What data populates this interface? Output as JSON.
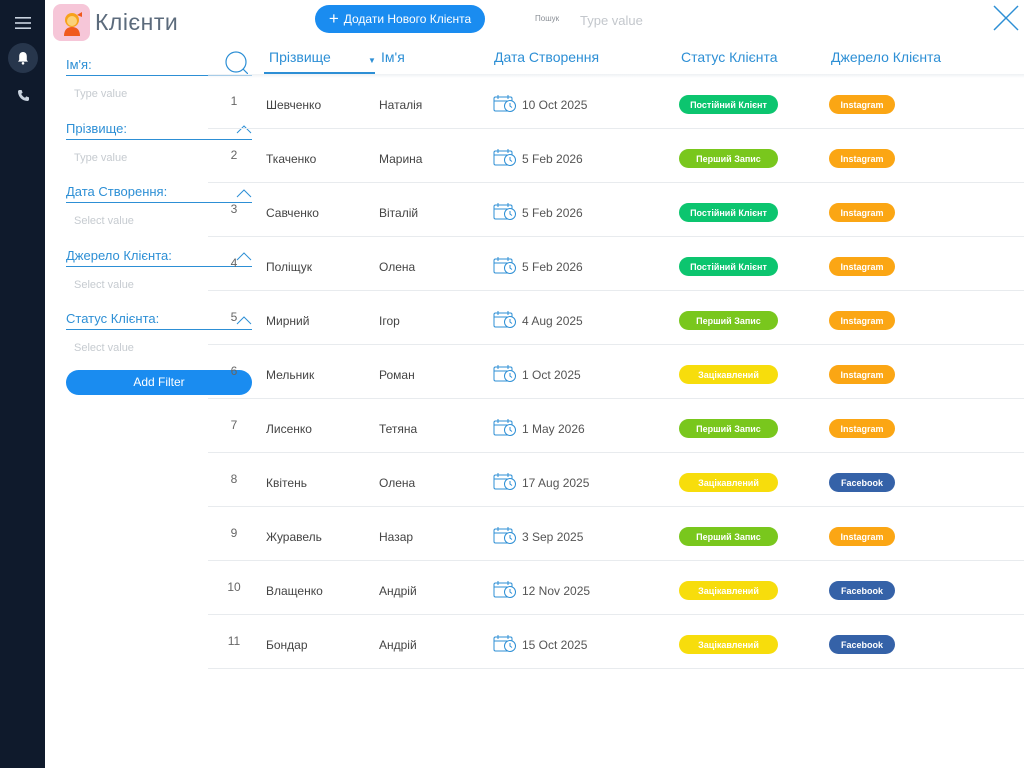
{
  "header": {
    "title": "Клієнти",
    "add_button": "Додати Нового Клієнта",
    "search_label": "Пошук",
    "search_placeholder": "Type value"
  },
  "filters": [
    {
      "label": "Ім'я:",
      "placeholder": "Type value"
    },
    {
      "label": "Прізвище:",
      "placeholder": "Type value"
    },
    {
      "label": "Дата Створення:",
      "placeholder": "Select value"
    },
    {
      "label": "Джерело Клієнта:",
      "placeholder": "Select value"
    },
    {
      "label": "Статус Клієнта:",
      "placeholder": "Select value"
    }
  ],
  "add_filter_label": "Add Filter",
  "columns": {
    "last_name": "Прізвище",
    "first_name": "Ім'я",
    "created": "Дата Створення",
    "status": "Статус Клієнта",
    "source": "Джерело Клієнта"
  },
  "status_colors": {
    "Постійний Клієнт": "#0cc56f",
    "Перший Запис": "#79c71d",
    "Зацікавлений": "#f7dd0c"
  },
  "source_colors": {
    "Instagram": "#fba614",
    "Facebook": "#3562a8"
  },
  "rows": [
    {
      "num": "1",
      "last": "Шевченко",
      "first": "Наталія",
      "date": "10 Oct 2025",
      "status": "Постійний Клієнт",
      "source": "Instagram"
    },
    {
      "num": "2",
      "last": "Ткаченко",
      "first": "Марина",
      "date": "5 Feb 2026",
      "status": "Перший Запис",
      "source": "Instagram"
    },
    {
      "num": "3",
      "last": "Савченко",
      "first": "Віталій",
      "date": "5 Feb 2026",
      "status": "Постійний Клієнт",
      "source": "Instagram"
    },
    {
      "num": "4",
      "last": "Поліщук",
      "first": "Олена",
      "date": "5 Feb 2026",
      "status": "Постійний Клієнт",
      "source": "Instagram"
    },
    {
      "num": "5",
      "last": "Мирний",
      "first": "Ігор",
      "date": "4 Aug 2025",
      "status": "Перший Запис",
      "source": "Instagram"
    },
    {
      "num": "6",
      "last": "Мельник",
      "first": "Роман",
      "date": "1 Oct 2025",
      "status": "Зацікавлений",
      "source": "Instagram"
    },
    {
      "num": "7",
      "last": "Лисенко",
      "first": "Тетяна",
      "date": "1 May 2026",
      "status": "Перший Запис",
      "source": "Instagram"
    },
    {
      "num": "8",
      "last": "Квітень",
      "first": "Олена",
      "date": "17 Aug 2025",
      "status": "Зацікавлений",
      "source": "Facebook"
    },
    {
      "num": "9",
      "last": "Журавель",
      "first": "Назар",
      "date": "3 Sep 2025",
      "status": "Перший Запис",
      "source": "Instagram"
    },
    {
      "num": "10",
      "last": "Влащенко",
      "first": "Андрій",
      "date": "12 Nov 2025",
      "status": "Зацікавлений",
      "source": "Facebook"
    },
    {
      "num": "11",
      "last": "Бондар",
      "first": "Андрій",
      "date": "15 Oct 2025",
      "status": "Зацікавлений",
      "source": "Facebook"
    }
  ]
}
